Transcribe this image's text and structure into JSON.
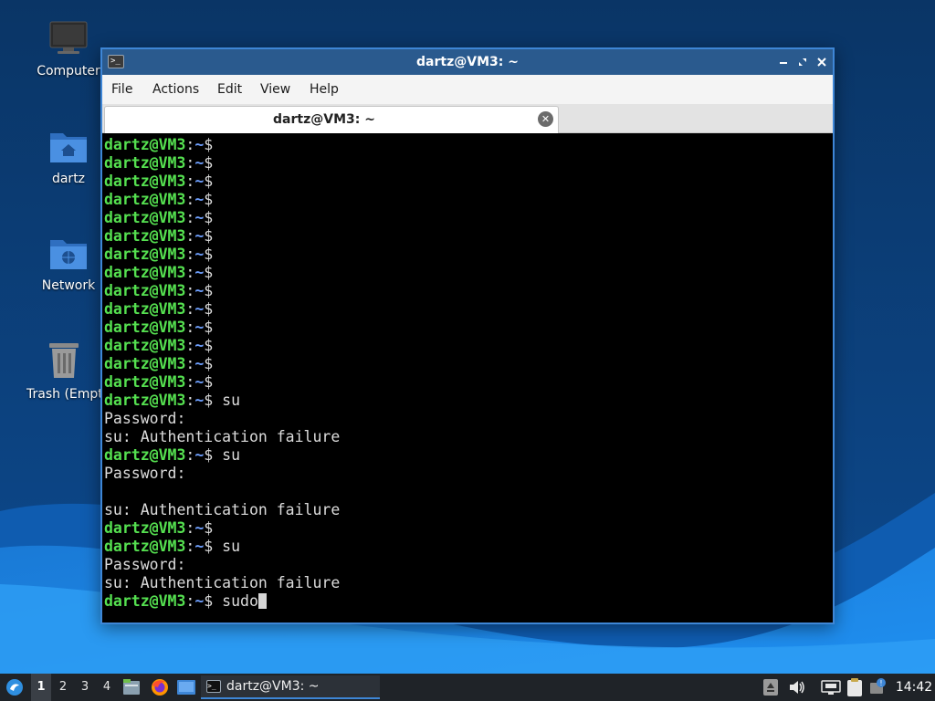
{
  "desktop": {
    "icons": [
      {
        "label": "Computer",
        "icon": "computer-icon"
      },
      {
        "label": "dartz",
        "icon": "home-folder-icon"
      },
      {
        "label": "Network",
        "icon": "network-folder-icon"
      },
      {
        "label": "Trash (Empty)",
        "icon": "trash-icon"
      }
    ]
  },
  "window": {
    "title": "dartz@VM3: ~",
    "buttons": {
      "minimize": "minimize-icon",
      "maximize": "maximize-icon",
      "close": "close-icon"
    },
    "menu": [
      "File",
      "Actions",
      "Edit",
      "View",
      "Help"
    ],
    "tab": {
      "label": "dartz@VM3: ~",
      "close_icon": "tab-close-icon"
    },
    "terminal": {
      "prompt": {
        "user": "dartz@VM3",
        "separator": ":",
        "path": "~",
        "symbol": "$ "
      },
      "lines": [
        {
          "type": "prompt",
          "text": ""
        },
        {
          "type": "prompt",
          "text": ""
        },
        {
          "type": "prompt",
          "text": ""
        },
        {
          "type": "prompt",
          "text": ""
        },
        {
          "type": "prompt",
          "text": ""
        },
        {
          "type": "prompt",
          "text": ""
        },
        {
          "type": "prompt",
          "text": ""
        },
        {
          "type": "prompt",
          "text": ""
        },
        {
          "type": "prompt",
          "text": ""
        },
        {
          "type": "prompt",
          "text": ""
        },
        {
          "type": "prompt",
          "text": ""
        },
        {
          "type": "prompt",
          "text": ""
        },
        {
          "type": "prompt",
          "text": ""
        },
        {
          "type": "prompt",
          "text": ""
        },
        {
          "type": "prompt",
          "text": "su"
        },
        {
          "type": "output",
          "text": "Password:"
        },
        {
          "type": "output",
          "text": "su: Authentication failure"
        },
        {
          "type": "prompt",
          "text": "su"
        },
        {
          "type": "output",
          "text": "Password:"
        },
        {
          "type": "output",
          "text": ""
        },
        {
          "type": "output",
          "text": "su: Authentication failure"
        },
        {
          "type": "prompt",
          "text": ""
        },
        {
          "type": "prompt",
          "text": "su"
        },
        {
          "type": "output",
          "text": "Password:"
        },
        {
          "type": "output",
          "text": "su: Authentication failure"
        },
        {
          "type": "prompt",
          "text": "sudo",
          "cursor": true
        }
      ]
    }
  },
  "taskbar": {
    "start_icon": "lubuntu-menu-icon",
    "workspaces": [
      "1",
      "2",
      "3",
      "4"
    ],
    "active_workspace": "1",
    "launchers": [
      "file-manager-icon",
      "firefox-icon",
      "show-desktop-icon"
    ],
    "task": {
      "label": "dartz@VM3: ~",
      "icon": "terminal-icon"
    },
    "tray": [
      "eject-icon",
      "volume-icon",
      "network-wired-icon",
      "clipboard-icon",
      "update-notifier-icon"
    ],
    "clock": "14:42"
  },
  "colors": {
    "accent": "#3e86d6",
    "prompt_user": "#55e050",
    "prompt_path": "#6fa0ff",
    "terminal_bg": "#000000",
    "titlebar": "#2a5a8e"
  }
}
